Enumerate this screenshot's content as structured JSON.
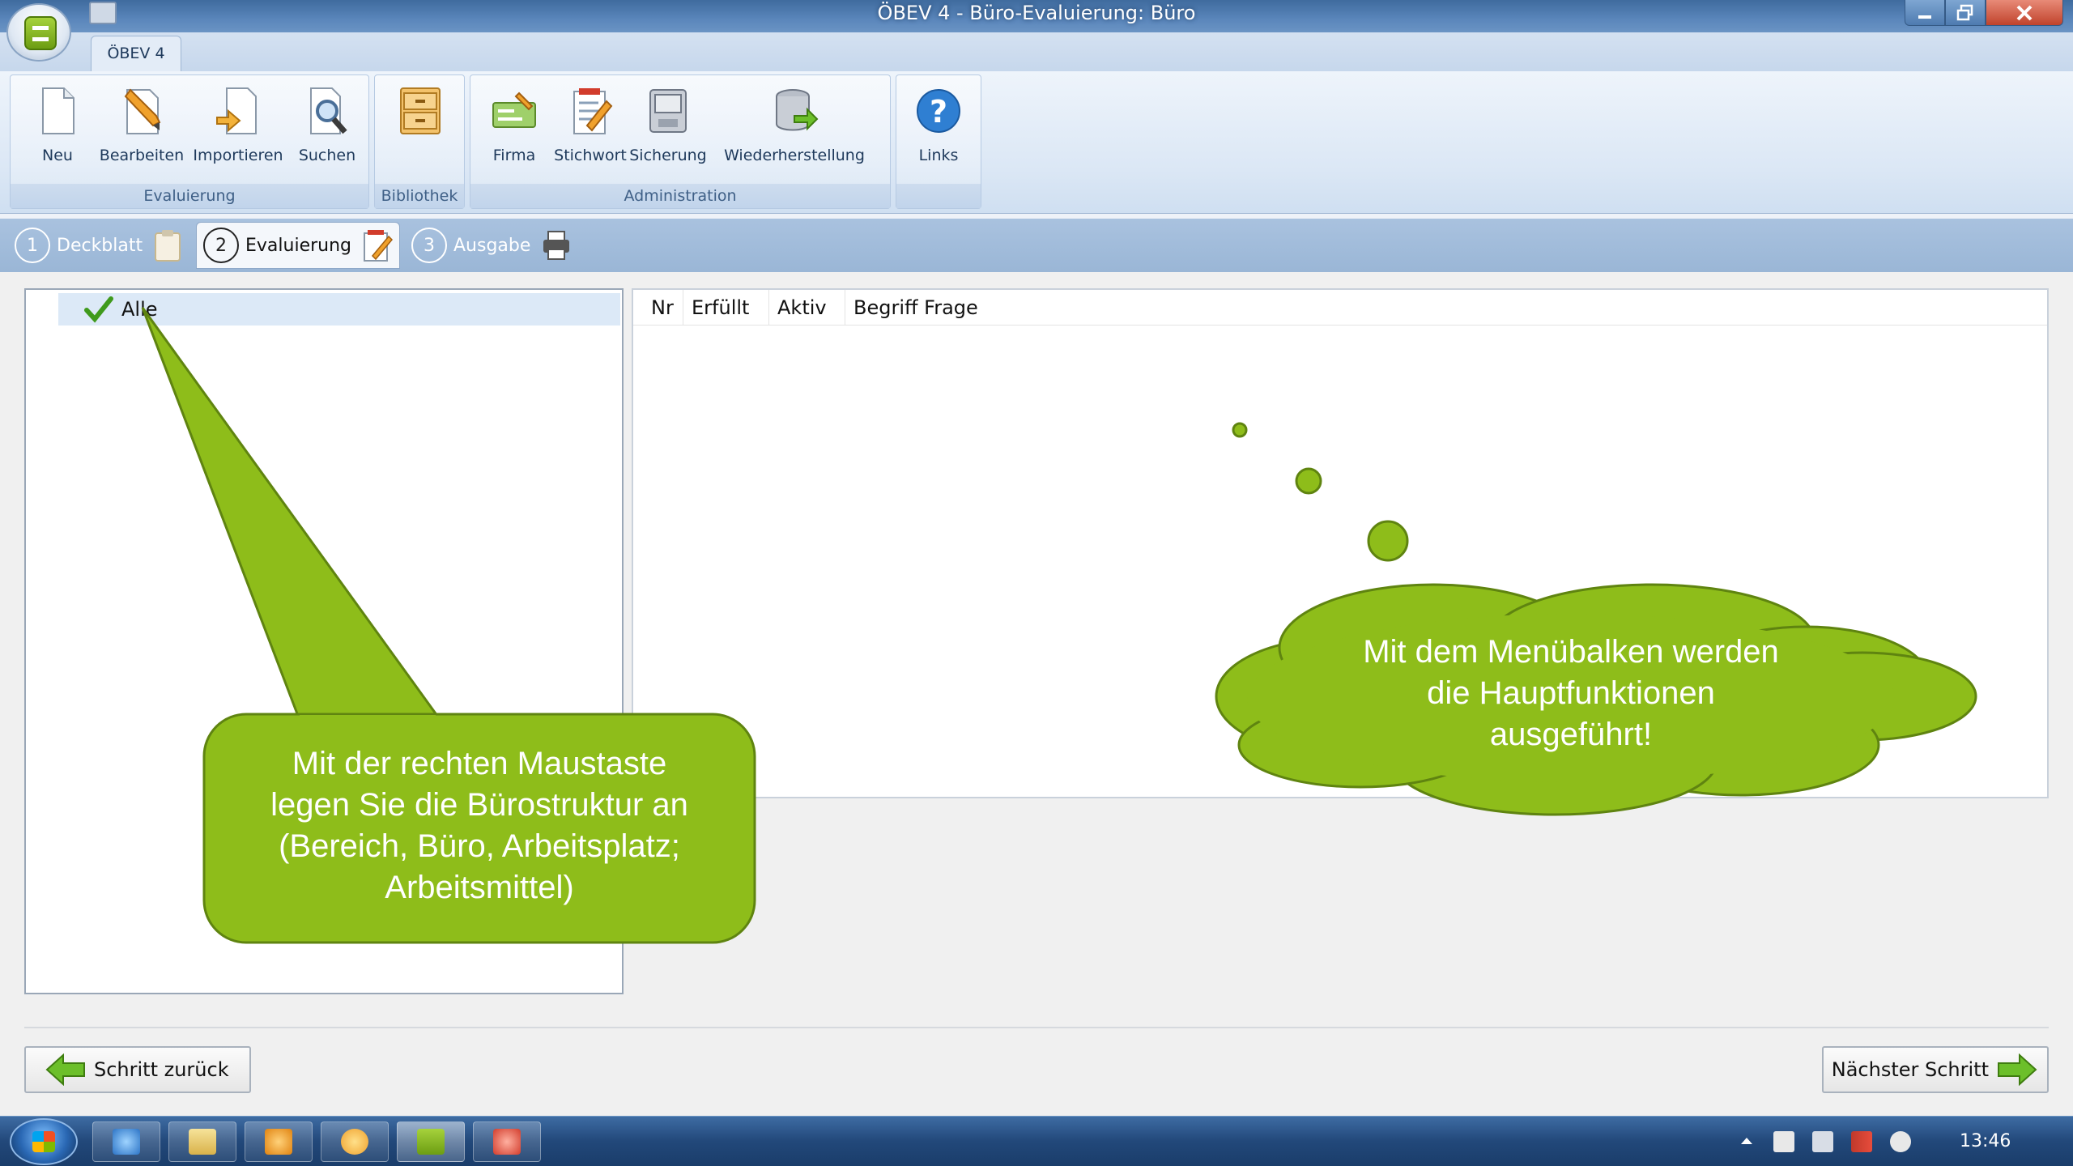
{
  "window": {
    "title": "ÖBEV 4 - Büro-Evaluierung: Büro"
  },
  "ribbon": {
    "tab": "ÖBEV 4",
    "groups": [
      {
        "label": "Evaluierung",
        "buttons": [
          {
            "label": "Neu",
            "icon": "new-document-icon"
          },
          {
            "label": "Bearbeiten",
            "icon": "edit-pencil-icon"
          },
          {
            "label": "Importieren",
            "icon": "import-icon"
          },
          {
            "label": "Suchen",
            "icon": "search-icon"
          }
        ]
      },
      {
        "label": "Bibliothek",
        "buttons": [
          {
            "label": "",
            "icon": "library-cabinet-icon"
          }
        ]
      },
      {
        "label": "Administration",
        "buttons": [
          {
            "label": "Firma",
            "icon": "company-icon"
          },
          {
            "label": "Stichwort",
            "icon": "keyword-icon"
          },
          {
            "label": "Sicherung",
            "icon": "backup-icon"
          },
          {
            "label": "Wiederherstellung",
            "icon": "restore-icon"
          }
        ]
      },
      {
        "label": "",
        "buttons": [
          {
            "label": "Links",
            "icon": "help-icon"
          }
        ]
      }
    ]
  },
  "steps": [
    {
      "num": "1",
      "label": "Deckblatt"
    },
    {
      "num": "2",
      "label": "Evaluierung"
    },
    {
      "num": "3",
      "label": "Ausgabe"
    }
  ],
  "tree": {
    "root": "Alle"
  },
  "grid": {
    "columns": [
      "Nr",
      "Erfüllt",
      "Aktiv",
      "Begriff Frage"
    ]
  },
  "nav": {
    "back": "Schritt zurück",
    "next": "Nächster Schritt"
  },
  "callouts": {
    "left": [
      "Mit der rechten Maustaste",
      "legen Sie die Bürostruktur an",
      "(Bereich, Büro, Arbeitsplatz;",
      "Arbeitsmittel)"
    ],
    "right": [
      "Mit dem Menübalken werden",
      "die Hauptfunktionen",
      "ausgeführt!"
    ]
  },
  "taskbar": {
    "clock": "13:46"
  },
  "colors": {
    "callout_green": "#8ebd1a",
    "callout_border": "#5f8410"
  }
}
